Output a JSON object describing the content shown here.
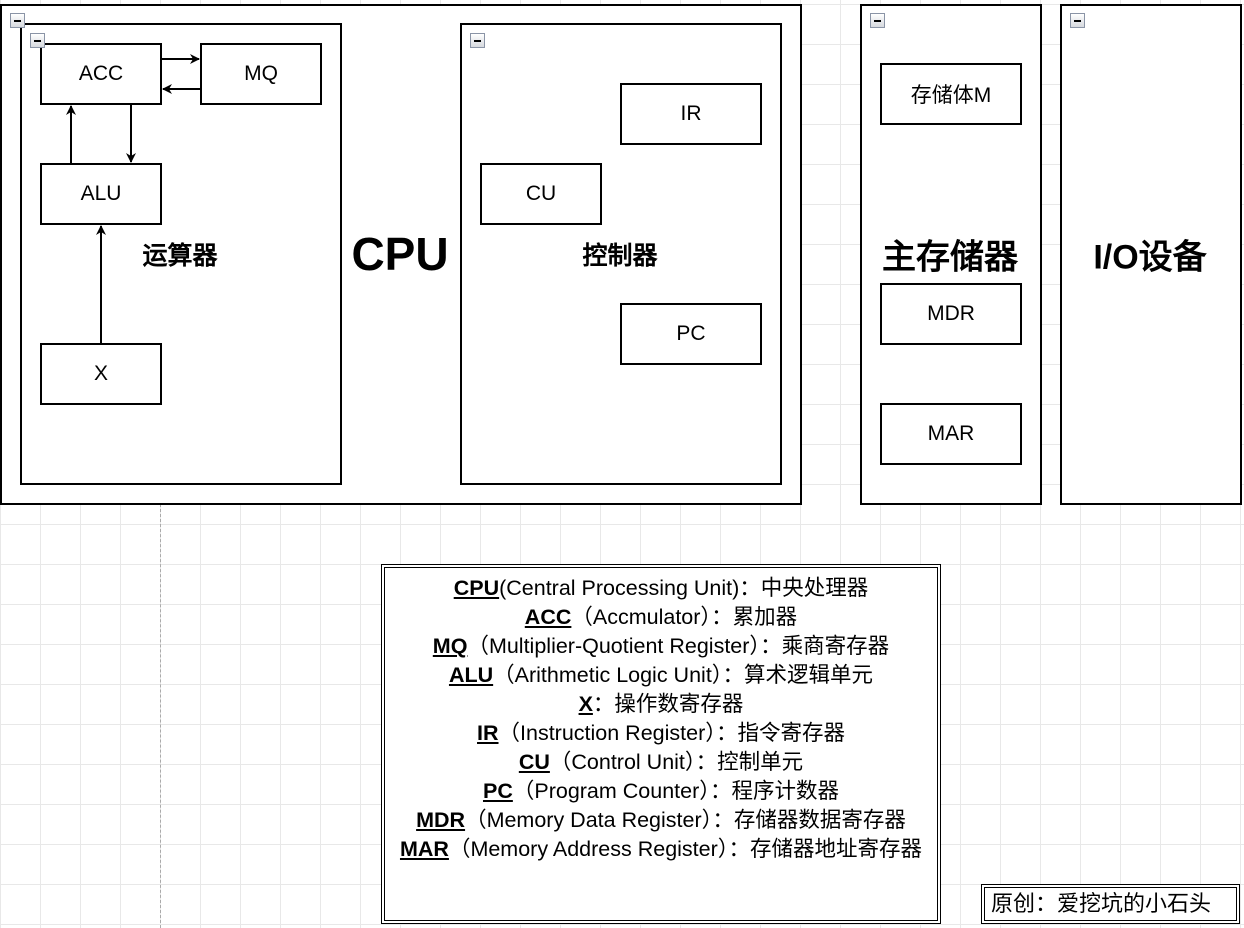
{
  "cpu": {
    "title": "CPU",
    "alu_section": {
      "title": "运算器",
      "registers": {
        "acc": "ACC",
        "mq": "MQ",
        "alu": "ALU",
        "x": "X"
      }
    },
    "control_section": {
      "title": "控制器",
      "registers": {
        "ir": "IR",
        "cu": "CU",
        "pc": "PC"
      }
    }
  },
  "memory": {
    "title": "主存储器",
    "registers": {
      "m": "存储体M",
      "mdr": "MDR",
      "mar": "MAR"
    }
  },
  "io": {
    "title": "I/O设备"
  },
  "legend": [
    {
      "abbr": "CPU",
      "desc": "(Central Processing Unit)：中央处理器"
    },
    {
      "abbr": "ACC",
      "desc": "（Accmulator）：累加器"
    },
    {
      "abbr": "MQ",
      "desc": "（Multiplier-Quotient Register）：乘商寄存器"
    },
    {
      "abbr": "ALU",
      "desc": "（Arithmetic Logic Unit）：算术逻辑单元"
    },
    {
      "abbr": "X",
      "desc": "：操作数寄存器"
    },
    {
      "abbr": "IR",
      "desc": "（Instruction Register）：指令寄存器"
    },
    {
      "abbr": "CU",
      "desc": "（Control Unit）：控制单元"
    },
    {
      "abbr": "PC",
      "desc": "（Program Counter）：程序计数器"
    },
    {
      "abbr": "MDR",
      "desc": "（Memory Data Register）：存储器数据寄存器"
    },
    {
      "abbr": "MAR",
      "desc": "（Memory Address Register）：存储器地址寄存器"
    }
  ],
  "credit": "原创：爱挖坑的小石头"
}
